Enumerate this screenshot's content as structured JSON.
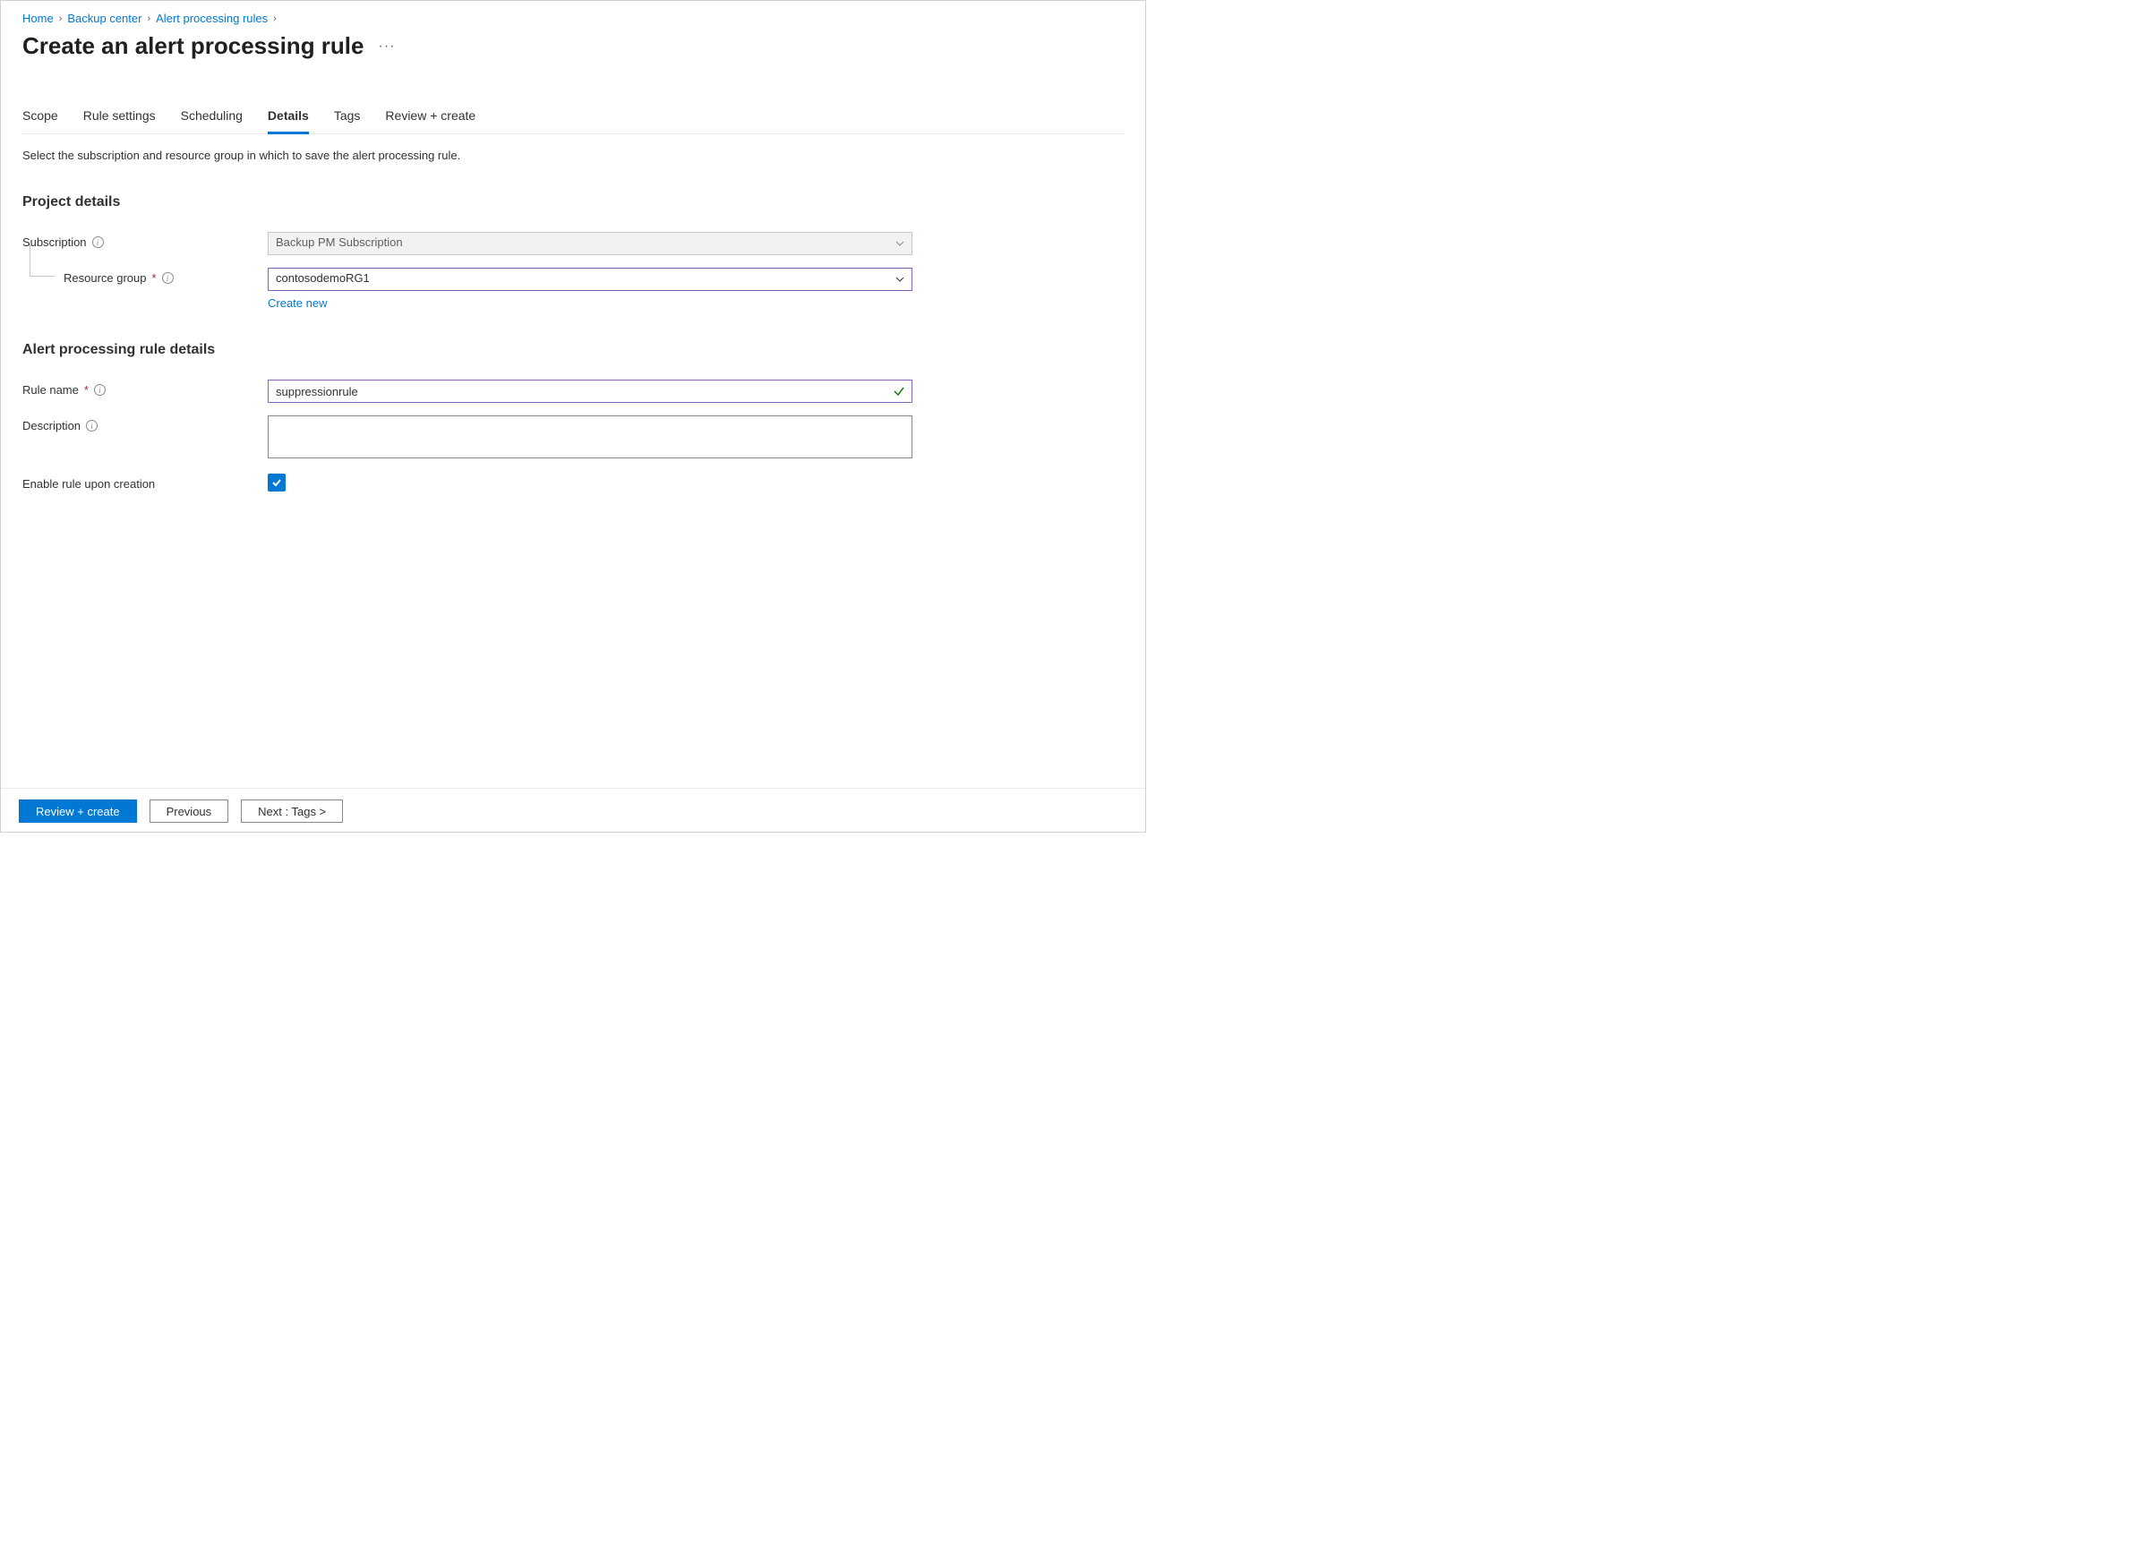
{
  "breadcrumb": [
    {
      "label": "Home"
    },
    {
      "label": "Backup center"
    },
    {
      "label": "Alert processing rules"
    }
  ],
  "page_title": "Create an alert processing rule",
  "tabs": [
    {
      "label": "Scope"
    },
    {
      "label": "Rule settings"
    },
    {
      "label": "Scheduling"
    },
    {
      "label": "Details"
    },
    {
      "label": "Tags"
    },
    {
      "label": "Review + create"
    }
  ],
  "active_tab_index": 3,
  "helper_text": "Select the subscription and resource group in which to save the alert processing rule.",
  "sections": {
    "project": {
      "heading": "Project details",
      "subscription_label": "Subscription",
      "subscription_value": "Backup PM Subscription",
      "resource_group_label": "Resource group",
      "resource_group_value": "contosodemoRG1",
      "create_new_label": "Create new"
    },
    "rule": {
      "heading": "Alert processing rule details",
      "rule_name_label": "Rule name",
      "rule_name_value": "suppressionrule",
      "description_label": "Description",
      "description_value": "",
      "enable_label": "Enable rule upon creation",
      "enable_checked": true
    }
  },
  "footer": {
    "primary": "Review + create",
    "previous": "Previous",
    "next": "Next : Tags >"
  }
}
